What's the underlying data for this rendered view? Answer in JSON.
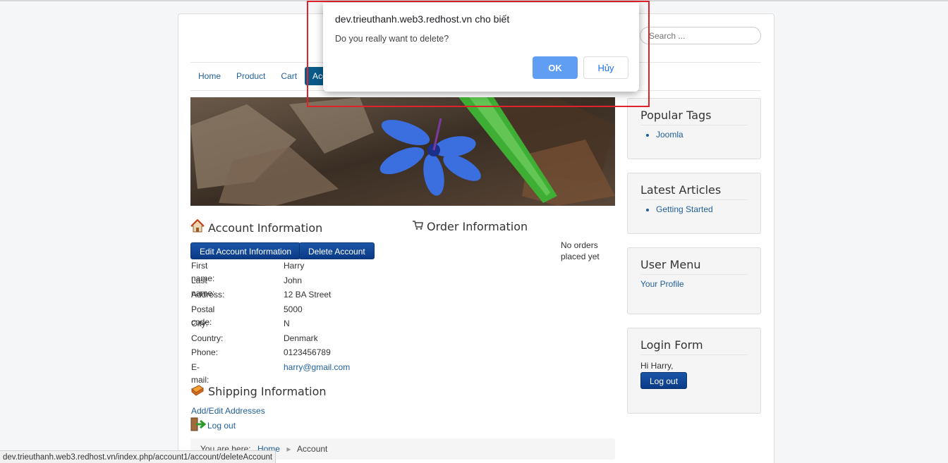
{
  "search": {
    "placeholder": "Search ..."
  },
  "nav": {
    "items": [
      "Home",
      "Product",
      "Cart",
      "Account"
    ]
  },
  "account": {
    "title": "Account Information",
    "edit_button": "Edit Account Information",
    "delete_button": "Delete Account",
    "fields": [
      {
        "label": "First name:",
        "value": "Harry"
      },
      {
        "label": "Last name:",
        "value": "John"
      },
      {
        "label": "Address:",
        "value": "12 BA Street"
      },
      {
        "label": "Postal code:",
        "value": "5000"
      },
      {
        "label": "City:",
        "value": "N"
      },
      {
        "label": "Country:",
        "value": "Denmark"
      },
      {
        "label": "Phone:",
        "value": "0123456789"
      },
      {
        "label": "E-mail:",
        "value": "harry@gmail.com"
      }
    ]
  },
  "orders": {
    "title": "Order Information",
    "empty": "No orders placed yet"
  },
  "shipping": {
    "title": "Shipping Information",
    "link": "Add/Edit Addresses",
    "logout": "Log out"
  },
  "breadcrumb": {
    "prefix": "You are here:",
    "home": "Home",
    "current": "Account"
  },
  "sidebar": {
    "popular_tags": {
      "title": "Popular Tags",
      "items": [
        "Joomla"
      ]
    },
    "latest_articles": {
      "title": "Latest Articles",
      "items": [
        "Getting Started"
      ]
    },
    "user_menu": {
      "title": "User Menu",
      "items": [
        "Your Profile"
      ]
    },
    "login_form": {
      "title": "Login Form",
      "greeting": "Hi Harry,",
      "logout": "Log out"
    }
  },
  "dialog": {
    "title": "dev.trieuthanh.web3.redhost.vn cho biết",
    "message": "Do you really want to delete?",
    "ok": "OK",
    "cancel": "Hủy"
  },
  "status_bar": {
    "url": "dev.trieuthanh.web3.redhost.vn/index.php/account1/account/deleteAccount"
  },
  "colors": {
    "accent": "#0a5a8a",
    "button": "#0b3a86",
    "link": "#1f5f99",
    "highlight": "#e0222a"
  }
}
